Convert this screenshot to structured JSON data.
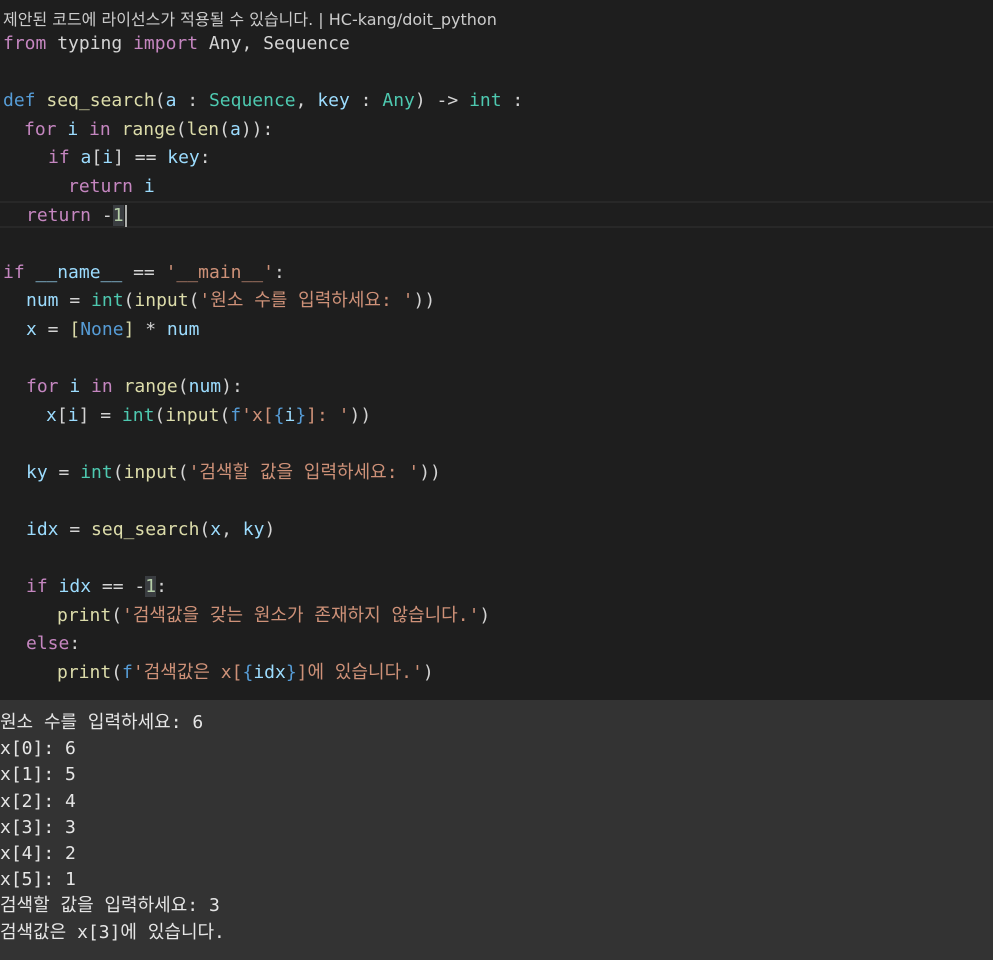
{
  "header": {
    "license_text": "제안된 코드에 라이선스가 적용될 수 있습니다. | HC-kang/doit_python"
  },
  "editor": {
    "lines": [
      {
        "t0": "from",
        "t1": " typing ",
        "t2": "import",
        "t3": " Any, Sequence"
      },
      {},
      {
        "t0": "def",
        "t1": " ",
        "t2": "seq_search",
        "t3": "(",
        "t4": "a",
        "t5": " : ",
        "t6": "Sequence",
        "t7": ", ",
        "t8": "key",
        "t9": " : ",
        "t10": "Any",
        "t11": ") -> ",
        "t12": "int",
        "t13": " :"
      },
      {
        "t0": "for",
        "t1": " ",
        "t2": "i",
        "t3": " ",
        "t4": "in",
        "t5": " ",
        "t6": "range",
        "t7": "(",
        "t8": "len",
        "t9": "(",
        "t10": "a",
        "t11": "))",
        "t12": ":"
      },
      {
        "t0": "if",
        "t1": " ",
        "t2": "a",
        "t3": "[",
        "t4": "i",
        "t5": "] == ",
        "t6": "key",
        "t7": ":"
      },
      {
        "t0": "return",
        "t1": " ",
        "t2": "i"
      },
      {
        "t0": "return",
        "t1": " -",
        "t2": "1"
      },
      {},
      {
        "t0": "if",
        "t1": " ",
        "t2": "__name__",
        "t3": " == ",
        "t4": "'__main__'",
        "t5": ":"
      },
      {
        "t0": "num",
        "t1": " = ",
        "t2": "int",
        "t3": "(",
        "t4": "input",
        "t5": "(",
        "t6": "'원소 수를 입력하세요: '",
        "t7": "))"
      },
      {
        "t0": "x",
        "t1": " = ",
        "t2": "[",
        "t3": "None",
        "t4": "]",
        "t5": " * ",
        "t6": "num"
      },
      {},
      {
        "t0": "for",
        "t1": " ",
        "t2": "i",
        "t3": " ",
        "t4": "in",
        "t5": " ",
        "t6": "range",
        "t7": "(",
        "t8": "num",
        "t9": ")",
        "t10": ":"
      },
      {
        "t0": "x",
        "t1": "[",
        "t2": "i",
        "t3": "] = ",
        "t4": "int",
        "t5": "(",
        "t6": "input",
        "t7": "(",
        "t8": "f",
        "t9": "'x[",
        "t10": "{",
        "t11": "i",
        "t12": "}",
        "t13": "]: '",
        "t14": "))"
      },
      {},
      {
        "t0": "ky",
        "t1": " = ",
        "t2": "int",
        "t3": "(",
        "t4": "input",
        "t5": "(",
        "t6": "'검색할 값을 입력하세요: '",
        "t7": "))"
      },
      {},
      {
        "t0": "idx",
        "t1": " = ",
        "t2": "seq_search",
        "t3": "(",
        "t4": "x",
        "t5": ", ",
        "t6": "ky",
        "t7": ")"
      },
      {},
      {
        "t0": "if",
        "t1": " ",
        "t2": "idx",
        "t3": " == -",
        "t4": "1",
        "t5": ":"
      },
      {
        "t0": "print",
        "t1": "(",
        "t2": "'검색값을 갖는 원소가 존재하지 않습니다.'",
        "t3": ")"
      },
      {
        "t0": "else",
        "t1": ":"
      },
      {
        "t0": "print",
        "t1": "(",
        "t2": "f",
        "t3": "'검색값은 x[",
        "t4": "{",
        "t5": "idx",
        "t6": "}",
        "t7": "]에 있습니다.'",
        "t8": ")"
      }
    ]
  },
  "terminal": {
    "lines": [
      "원소 수를 입력하세요: 6",
      "x[0]: 6",
      "x[1]: 5",
      "x[2]: 4",
      "x[3]: 3",
      "x[4]: 2",
      "x[5]: 1",
      "검색할 값을 입력하세요: 3",
      "검색값은 x[3]에 있습니다."
    ]
  },
  "colors": {
    "editor_bg": "#1e1e1e",
    "terminal_bg": "#333333",
    "keyword": "#569cd6",
    "control": "#c586c0",
    "function": "#dcdcaa",
    "variable": "#9cdcfe",
    "type": "#4ec9b0",
    "string": "#ce9178",
    "number": "#b5cea8"
  }
}
